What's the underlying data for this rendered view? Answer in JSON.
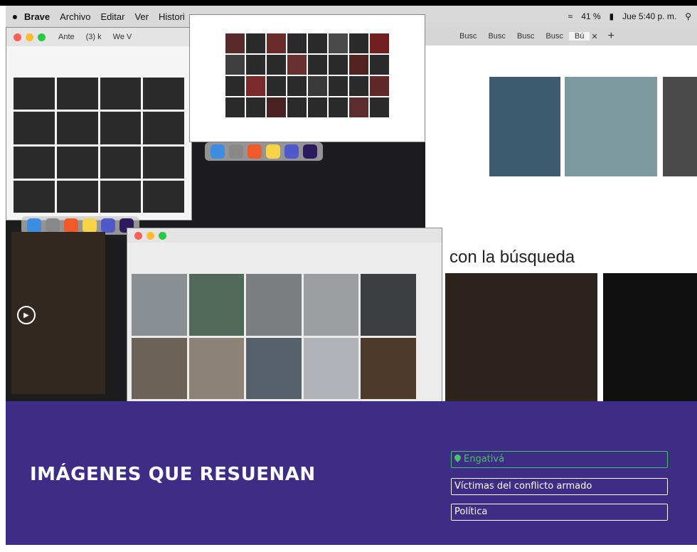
{
  "screenshot": {
    "menubar": {
      "apple_icon": "apple-icon",
      "items": [
        "Brave",
        "Archivo",
        "Editar",
        "Ver",
        "Histori"
      ],
      "status": {
        "battery": "41 %",
        "clock": "Jue 5:40 p. m."
      }
    },
    "left_window": {
      "tabs": [
        "Ante",
        "(3) k",
        "We V"
      ]
    },
    "right_window": {
      "tabs": [
        "Busc",
        "Busc",
        "Busc",
        "Busc",
        "Bú"
      ],
      "caption": "con la búsqueda"
    }
  },
  "article": {
    "title": "IMÁGENES QUE RESUENAN",
    "tags": [
      {
        "label": "Engativá",
        "kind": "location"
      },
      {
        "label": "Víctimas del conflicto armado",
        "kind": "topic"
      },
      {
        "label": "Política",
        "kind": "topic"
      }
    ],
    "colors": {
      "background": "#3d2d86",
      "location_tag": "#4cbf6b",
      "text": "#ffffff"
    }
  }
}
